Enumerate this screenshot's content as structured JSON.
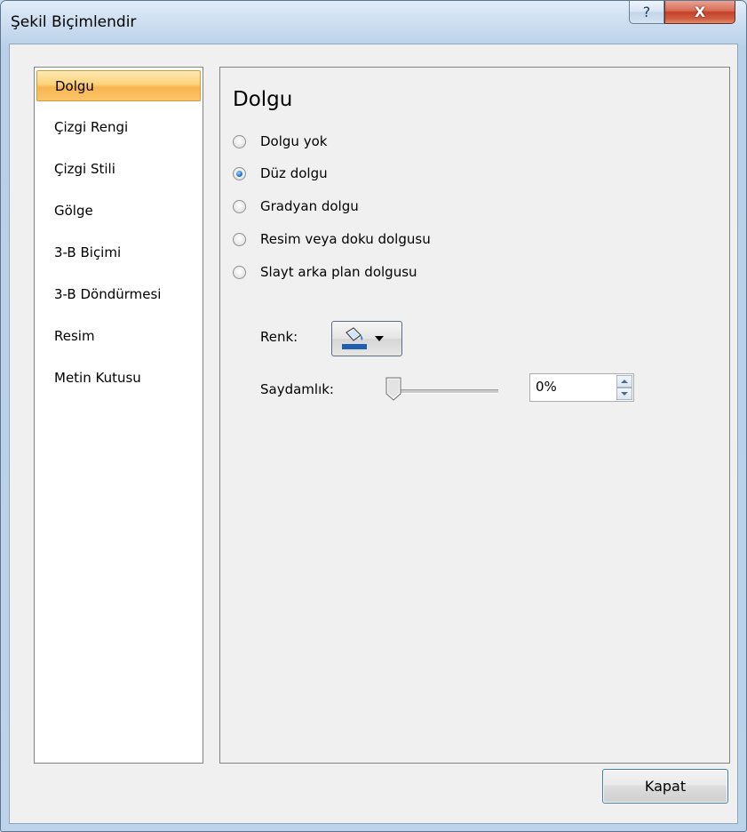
{
  "window": {
    "title": "Şekil Biçimlendir",
    "help_label": "?",
    "close_label": "X"
  },
  "nav": {
    "items": [
      {
        "label": "Dolgu",
        "selected": true
      },
      {
        "label": "Çizgi Rengi",
        "selected": false
      },
      {
        "label": "Çizgi Stili",
        "selected": false
      },
      {
        "label": "Gölge",
        "selected": false
      },
      {
        "label": "3-B Biçimi",
        "selected": false
      },
      {
        "label": "3-B Döndürmesi",
        "selected": false
      },
      {
        "label": "Resim",
        "selected": false
      },
      {
        "label": "Metin Kutusu",
        "selected": false
      }
    ]
  },
  "panel": {
    "title": "Dolgu",
    "fill_options": [
      {
        "label": "Dolgu yok",
        "checked": false
      },
      {
        "label": "Düz dolgu",
        "checked": true
      },
      {
        "label": "Gradyan dolgu",
        "checked": false
      },
      {
        "label": "Resim veya doku dolgusu",
        "checked": false
      },
      {
        "label": "Slayt arka plan dolgusu",
        "checked": false
      }
    ],
    "color_label": "Renk:",
    "color_icon": "paint-bucket-icon",
    "color_value": "#1f5fb2",
    "transparency_label": "Saydamlık:",
    "transparency_value": "0%",
    "transparency_level": 0
  },
  "footer": {
    "close_button": "Kapat"
  }
}
